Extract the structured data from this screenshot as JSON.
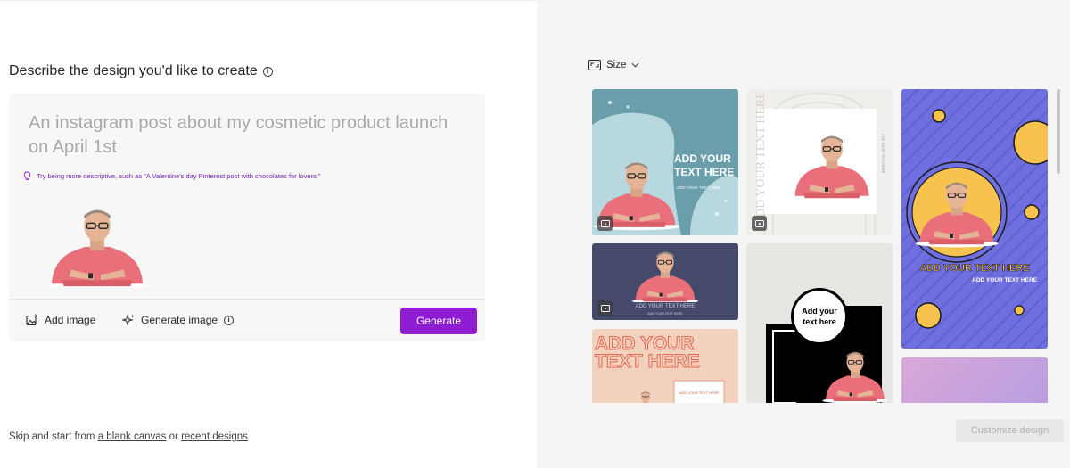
{
  "left": {
    "heading": "Describe the design you'd like to create",
    "prompt_placeholder": "An instagram post about my cosmetic product launch on April 1st",
    "tip": "Try being more descriptive, such as \"A Valentine's day Pinterest post with chocolates for lovers.\"",
    "add_image_label": "Add image",
    "generate_image_label": "Generate image",
    "generate_button": "Generate",
    "skip_prefix": "Skip and start from ",
    "blank_canvas_link": "a blank canvas",
    "skip_or": " or ",
    "recent_designs_link": "recent designs"
  },
  "right": {
    "size_label": "Size",
    "customize_button": "Customize design",
    "templates": {
      "t1": {
        "line1": "ADD YOUR",
        "line2": "TEXT HERE",
        "sub": "ADD YOUR TEXT HERE"
      },
      "t2": {
        "side_text": "ADD YOUR TEXT HERE",
        "side_small": "ADD YOUR TEXT HERE"
      },
      "t3": {
        "line1": "ADD YOUR TEXT HERE",
        "sub": "ADD YOUR TEXT HERE"
      },
      "t4": {
        "line1": "ADD YOUR TEXT HERE",
        "sub": "ADD YOUR TEXT HERE"
      },
      "t5": {
        "line1": "ADD YOUR",
        "line2": "TEXT HERE",
        "sub": "ADD YOUR TEXT HERE"
      },
      "t6": {
        "line1": "Add your",
        "line2": "text here"
      }
    }
  },
  "colors": {
    "accent": "#8f1dd4",
    "teal_card": "#6a9eab",
    "navy_card": "#454a6b",
    "purple_card": "#6f6fe0",
    "peach_card": "#f2d2bf",
    "lilac_card": "#c79bd8"
  }
}
